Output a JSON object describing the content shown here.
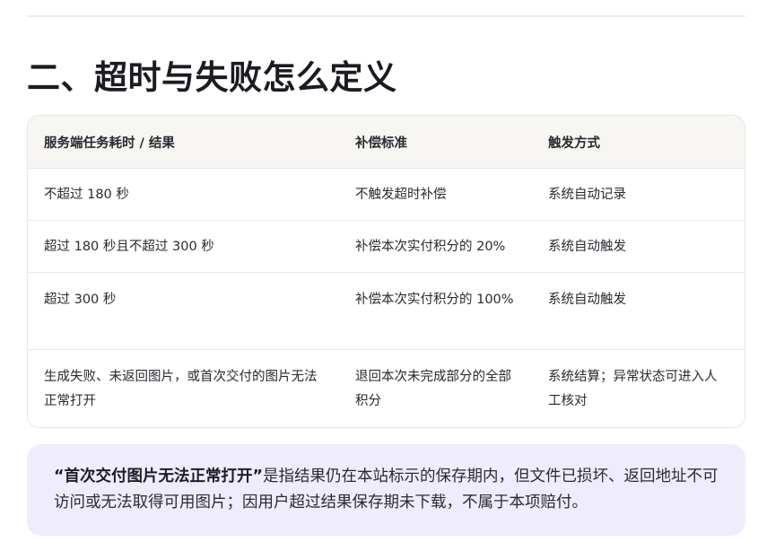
{
  "section": {
    "title": "二、超时与失败怎么定义"
  },
  "table": {
    "headers": [
      "服务端任务耗时 / 结果",
      "补偿标准",
      "触发方式"
    ],
    "rows": [
      [
        "不超过 180 秒",
        "不触发超时补偿",
        "系统自动记录"
      ],
      [
        "超过 180 秒且不超过 300 秒",
        "补偿本次实付积分的 20%",
        "系统自动触发"
      ],
      [
        "超过 300 秒",
        "补偿本次实付积分的 100%",
        "系统自动触发"
      ],
      [
        "生成失败、未返回图片，或首次交付的图片无法正常打开",
        "退回本次未完成部分的全部积分",
        "系统结算；异常状态可进入人工核对"
      ]
    ]
  },
  "note": {
    "term": "“首次交付图片无法正常打开”",
    "text": "是指结果仍在本站标示的保存期内，但文件已损坏、返回地址不可访问或无法取得可用图片；因用户超过结果保存期未下载，不属于本项赔付。"
  }
}
